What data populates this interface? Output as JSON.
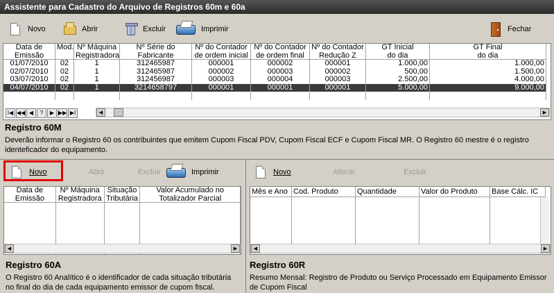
{
  "window": {
    "title": "Assistente para Cadastro do Arquivo de Registros 60m e 60a"
  },
  "toolbar_top": {
    "novo": "Novo",
    "abrir": "Abrir",
    "excluir": "Excluir",
    "imprimir": "Imprimir",
    "fechar": "Fechar"
  },
  "grid60m": {
    "headers": [
      [
        "Data de",
        "Emissão"
      ],
      [
        "Mod.",
        ""
      ],
      [
        "Nº Máquina",
        "Registradora"
      ],
      [
        "Nº Série do",
        "Fabricante"
      ],
      [
        "Nº do Contador",
        "de ordem inicial"
      ],
      [
        "Nº do Contador",
        "de ordem final"
      ],
      [
        "Nº do Contador",
        "Redução Z"
      ],
      [
        "GT Inicial",
        "do dia"
      ],
      [
        "GT Final",
        "do dia"
      ]
    ],
    "rows": [
      [
        "01/07/2010",
        "02",
        "1",
        "312465987",
        "000001",
        "000002",
        "000001",
        "1.000,00",
        "1.000,00"
      ],
      [
        "02/07/2010",
        "02",
        "1",
        "312465987",
        "000002",
        "000003",
        "000002",
        "500,00",
        "1.500,00"
      ],
      [
        "03/07/2010",
        "02",
        "1",
        "312456987",
        "000003",
        "000004",
        "000003",
        "2.500,00",
        "4.000,00"
      ],
      [
        "04/07/2010",
        "02",
        "1",
        "3214658797",
        "000001",
        "000001",
        "000001",
        "5.000,00",
        "9.000,00"
      ]
    ],
    "nav_buttons": [
      "I◀",
      "◀◀",
      "◀",
      "?",
      "▶",
      "▶▶",
      "▶I"
    ]
  },
  "registro60m": {
    "title": "Registro 60M",
    "text": "Deverão informar o Registro 60 os contribuintes que emitem Cupom Fiscal PDV, Cupom Fiscal ECF e Cupom Fiscal MR. O Registro 60 mestre é o registro identeficador do equipamento."
  },
  "toolbar_60a": {
    "novo": "Novo",
    "abrir": "Abrir",
    "excluir": "Excluir",
    "imprimir": "Imprimir"
  },
  "toolbar_60r": {
    "novo": "Novo",
    "alterar": "Alterar",
    "excluir": "Excluir"
  },
  "grid60a": {
    "headers": [
      [
        "Data de",
        "Emissão"
      ],
      [
        "Nº Máquina",
        "Registradora"
      ],
      [
        "Situação",
        "Tributária"
      ],
      [
        "Valor Acumulado no",
        "Totalizador Parcial"
      ]
    ]
  },
  "grid60r": {
    "headers": [
      "Mês e Ano",
      "Cod. Produto",
      "Quantidade",
      "Valor do Produto",
      "Base Cálc. IC"
    ]
  },
  "registro60a": {
    "title": "Registro 60A",
    "text": "O Registro 60 Analítico é o identificador de cada situação tributária no final do dia de cada equipamento emissor de cupom fiscal."
  },
  "registro60r": {
    "title": "Registro 60R",
    "text": "Resumo Mensal: Registro de Produto ou Serviço Processado em Equipamento Emissor de Cupom Fiscal"
  },
  "colors": {
    "highlight": "#e00000",
    "selected_row": "#3a3a3a",
    "titlebar": "#3a3a3a"
  }
}
